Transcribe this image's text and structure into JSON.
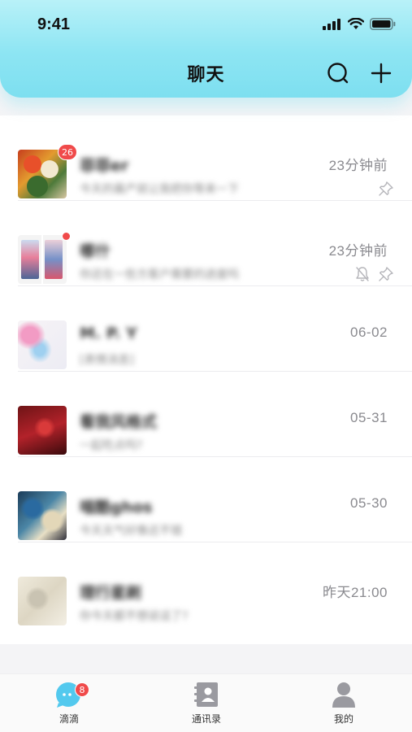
{
  "status_bar": {
    "time": "9:41"
  },
  "header": {
    "title": "聊天"
  },
  "chats": [
    {
      "name": "菲菲er",
      "preview": "今天的最产就让我把你等来一下",
      "time": "23分钟前",
      "unread_count": "26",
      "pinned": true,
      "muted": false
    },
    {
      "name": "哪什",
      "preview": "你还在一些方客户需要的进度吗",
      "time": "23分钟前",
      "unread_dot": true,
      "pinned": true,
      "muted": true
    },
    {
      "name": "M. P. Y",
      "preview": "[表情消息]",
      "time": "06-02"
    },
    {
      "name": "看我风格式",
      "preview": "一起吃点吗?",
      "time": "05-31"
    },
    {
      "name": "喵酷ghos",
      "preview": "今天天气好像还不错",
      "time": "05-30"
    },
    {
      "name": "理行星刷",
      "preview": "你今天都不想说话了?",
      "time": "昨天21:00"
    }
  ],
  "tabbar": {
    "items": [
      {
        "label": "滴滴",
        "badge": "8"
      },
      {
        "label": "通讯录"
      },
      {
        "label": "我的"
      }
    ]
  },
  "colors": {
    "accent": "#7ddff0",
    "badge": "#f04a4a",
    "tab_active": "#53c9ee"
  }
}
